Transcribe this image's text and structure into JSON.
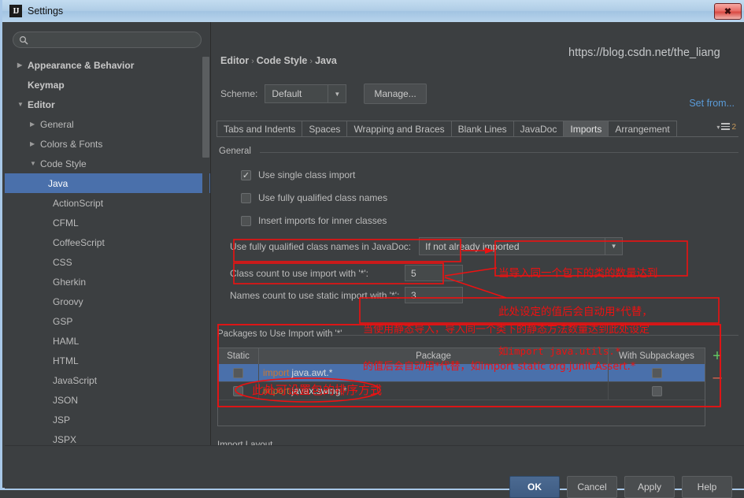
{
  "window": {
    "title": "Settings",
    "app_icon": "intellij-idea-icon",
    "close_label": "✖"
  },
  "sidebar": {
    "search": {
      "placeholder": "",
      "value": "",
      "icon": "search-icon"
    },
    "items": [
      {
        "label": "Appearance & Behavior",
        "arrow": "▶",
        "depth": 0,
        "bold": true,
        "selected": false
      },
      {
        "label": "Keymap",
        "arrow": "",
        "depth": 0,
        "bold": true,
        "selected": false
      },
      {
        "label": "Editor",
        "arrow": "▼",
        "depth": 0,
        "bold": true,
        "selected": false
      },
      {
        "label": "General",
        "arrow": "▶",
        "depth": 1,
        "bold": false,
        "selected": false
      },
      {
        "label": "Colors & Fonts",
        "arrow": "▶",
        "depth": 1,
        "bold": false,
        "selected": false
      },
      {
        "label": "Code Style",
        "arrow": "▼",
        "depth": 1,
        "bold": false,
        "selected": false
      },
      {
        "label": "Java",
        "arrow": "",
        "depth": 2,
        "bold": false,
        "selected": true
      },
      {
        "label": "ActionScript",
        "arrow": "",
        "depth": 2,
        "bold": false,
        "selected": false
      },
      {
        "label": "CFML",
        "arrow": "",
        "depth": 2,
        "bold": false,
        "selected": false
      },
      {
        "label": "CoffeeScript",
        "arrow": "",
        "depth": 2,
        "bold": false,
        "selected": false
      },
      {
        "label": "CSS",
        "arrow": "",
        "depth": 2,
        "bold": false,
        "selected": false
      },
      {
        "label": "Gherkin",
        "arrow": "",
        "depth": 2,
        "bold": false,
        "selected": false
      },
      {
        "label": "Groovy",
        "arrow": "",
        "depth": 2,
        "bold": false,
        "selected": false
      },
      {
        "label": "GSP",
        "arrow": "",
        "depth": 2,
        "bold": false,
        "selected": false
      },
      {
        "label": "HAML",
        "arrow": "",
        "depth": 2,
        "bold": false,
        "selected": false
      },
      {
        "label": "HTML",
        "arrow": "",
        "depth": 2,
        "bold": false,
        "selected": false
      },
      {
        "label": "JavaScript",
        "arrow": "",
        "depth": 2,
        "bold": false,
        "selected": false
      },
      {
        "label": "JSON",
        "arrow": "",
        "depth": 2,
        "bold": false,
        "selected": false
      },
      {
        "label": "JSP",
        "arrow": "",
        "depth": 2,
        "bold": false,
        "selected": false
      },
      {
        "label": "JSPX",
        "arrow": "",
        "depth": 2,
        "bold": false,
        "selected": false
      }
    ]
  },
  "main": {
    "breadcrumb": {
      "part1": "Editor",
      "part2": "Code Style",
      "part3": "Java",
      "separator": "›"
    },
    "scheme": {
      "label": "Scheme:",
      "value": "Default",
      "arrow": "▼",
      "manage_label": "Manage...",
      "set_from_label": "Set from..."
    },
    "tabs": [
      {
        "label": "Tabs and Indents",
        "active": false
      },
      {
        "label": "Spaces",
        "active": false
      },
      {
        "label": "Wrapping and Braces",
        "active": false
      },
      {
        "label": "Blank Lines",
        "active": false
      },
      {
        "label": "JavaDoc",
        "active": false
      },
      {
        "label": "Imports",
        "active": true
      },
      {
        "label": "Arrangement",
        "active": false
      }
    ],
    "tab_overflow": {
      "arrow": "▾",
      "icon": "list-lines-icon",
      "count": "2"
    },
    "general": {
      "legend": "General",
      "checkboxes": [
        {
          "label": "Use single class import",
          "checked": true,
          "mark": "✓"
        },
        {
          "label": "Use fully qualified class names",
          "checked": false,
          "mark": ""
        },
        {
          "label": "Insert imports for inner classes",
          "checked": false,
          "mark": ""
        }
      ],
      "javadoc": {
        "label": "Use fully qualified class names in JavaDoc:",
        "value": "If not already imported",
        "arrow": "▼"
      },
      "class_count": {
        "label": "Class count to use import with '*':",
        "value": "5"
      },
      "names_count": {
        "label": "Names count to use static import with '*':",
        "value": "3"
      }
    },
    "packages": {
      "legend": "Packages to Use Import with '*'",
      "columns": {
        "static": "Static",
        "package": "Package",
        "subpackages": "With Subpackages"
      },
      "rows": [
        {
          "static_checked": false,
          "keyword": "import",
          "package": "java.awt.*",
          "sub_checked": false,
          "selected": true
        },
        {
          "static_checked": false,
          "keyword": "import",
          "package": "javax.swing.*",
          "sub_checked": false,
          "selected": false
        }
      ],
      "add_label": "+",
      "remove_label": "–"
    },
    "import_layout": {
      "legend": "Import Layout"
    }
  },
  "footer": {
    "buttons": [
      {
        "label": "OK",
        "primary": true
      },
      {
        "label": "Cancel",
        "primary": false
      },
      {
        "label": "Apply",
        "primary": false
      },
      {
        "label": "Help",
        "primary": false
      }
    ],
    "watermark": "https://blog.csdn.net/the_liang"
  },
  "annotations": {
    "note1_line1": "当导入同一个包下的类的数量达到",
    "note1_line2": "此处设定的值后会自动用*代替，",
    "note1_line3": "如import java.utils.*",
    "note2_line1": "当使用静态导入，导入同一个类下的静态方法数量达到此处设定",
    "note2_line2": "的值后会自动用*代替，如import static org.junit.Assert.*",
    "note3": "此处可设置包的排序方式"
  },
  "colors": {
    "window_bg": "#3c3f41",
    "selection_blue": "#4a70ab",
    "link_blue": "#5a9bd8",
    "annotation_red": "#ee1111",
    "keyword_orange": "#cc7832",
    "add_green": "#62c462",
    "remove_red": "#d9634d",
    "titlebar_blue": "#b0cde6"
  }
}
